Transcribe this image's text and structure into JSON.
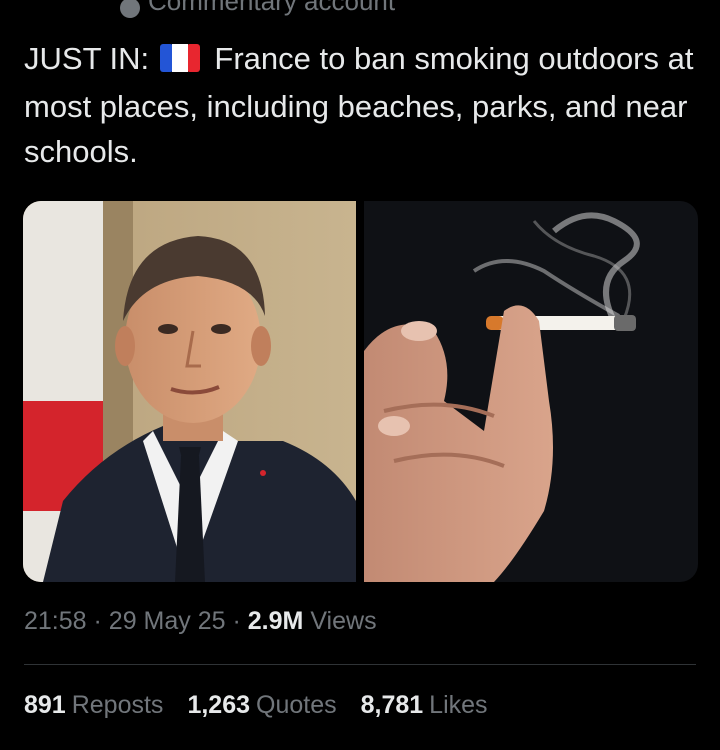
{
  "header": {
    "account_label": "Commentary account"
  },
  "tweet": {
    "prefix": "JUST IN:",
    "flag_icon": "france-flag-icon",
    "text": "France to ban smoking outdoors at most places, including beaches, parks, and near schools."
  },
  "media": {
    "left_image": "photo-man-in-suit",
    "right_image": "photo-hand-holding-cigarette"
  },
  "meta": {
    "time": "21:58",
    "separator": "·",
    "date": "29 May 25",
    "views_count": "2.9M",
    "views_label": "Views"
  },
  "stats": {
    "reposts_count": "891",
    "reposts_label": "Reposts",
    "quotes_count": "1,263",
    "quotes_label": "Quotes",
    "likes_count": "8,781",
    "likes_label": "Likes"
  },
  "colors": {
    "background": "#000000",
    "text": "#e7e9ea",
    "muted": "#71767b",
    "divider": "#2f3336"
  }
}
